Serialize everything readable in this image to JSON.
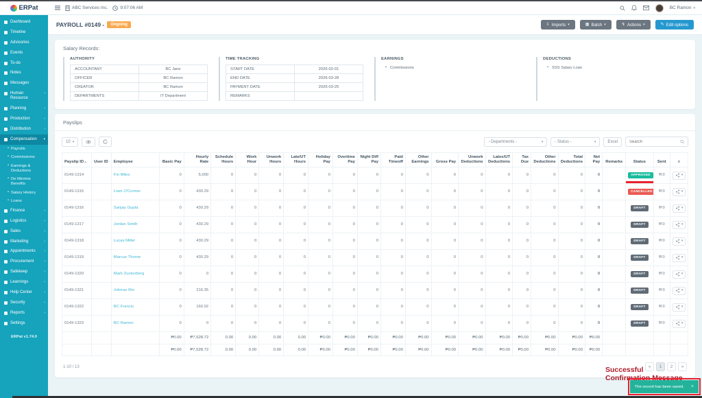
{
  "chrome": {
    "logo": {
      "text": "ERPat"
    },
    "topbar": {
      "company": "ABC Services Inc.",
      "time": "9:07:06 AM",
      "user": "BC Ramon"
    }
  },
  "sidebar": {
    "version": "ERPat v1.74.0",
    "sections": [
      {
        "type": "link",
        "label": "Dashboard",
        "icon": "dashboard-icon"
      },
      {
        "type": "link",
        "label": "Timeline",
        "icon": "timeline-icon"
      },
      {
        "type": "link",
        "label": "Advisories",
        "icon": "advisories-icon"
      },
      {
        "type": "link",
        "label": "Events",
        "icon": "events-icon"
      },
      {
        "type": "link",
        "label": "To-do",
        "icon": "todo-icon"
      },
      {
        "type": "link",
        "label": "Notes",
        "icon": "notes-icon"
      },
      {
        "type": "link",
        "label": "Messages",
        "icon": "messages-icon"
      },
      {
        "type": "parent",
        "label": "Human Resource",
        "icon": "human-resource-icon"
      },
      {
        "type": "parent",
        "label": "Planning",
        "icon": "planning-icon"
      },
      {
        "type": "parent",
        "label": "Production",
        "icon": "production-icon"
      },
      {
        "type": "parent",
        "label": "Distribution",
        "icon": "distribution-icon"
      },
      {
        "type": "parent",
        "label": "Compensation",
        "icon": "compensation-icon",
        "active": true,
        "expanded": true,
        "children": [
          "Payrolls",
          "Commissions",
          "Earnings & Deductions",
          "De Minimis Benefits",
          "Salary History",
          "Loans"
        ]
      },
      {
        "type": "parent",
        "label": "Finance",
        "icon": "finance-icon"
      },
      {
        "type": "parent",
        "label": "Logistics",
        "icon": "logistics-icon"
      },
      {
        "type": "parent",
        "label": "Sales",
        "icon": "sales-icon"
      },
      {
        "type": "parent",
        "label": "Marketing",
        "icon": "marketing-icon"
      },
      {
        "type": "parent",
        "label": "Appointments",
        "icon": "appointments-icon"
      },
      {
        "type": "parent",
        "label": "Procurement",
        "icon": "procurement-icon"
      },
      {
        "type": "parent",
        "label": "Safekeep",
        "icon": "safekeep-icon"
      },
      {
        "type": "parent",
        "label": "Learnings",
        "icon": "learnings-icon"
      },
      {
        "type": "parent",
        "label": "Help Center",
        "icon": "help-center-icon"
      },
      {
        "type": "parent",
        "label": "Security",
        "icon": "security-icon"
      },
      {
        "type": "parent",
        "label": "Reports",
        "icon": "reports-icon"
      },
      {
        "type": "link",
        "label": "Settings",
        "icon": "settings-icon"
      }
    ]
  },
  "page": {
    "title": "PAYROLL #0149 -",
    "status_badge": "Ongoing",
    "buttons": [
      {
        "label": "Imports",
        "caret": "▾",
        "icon": "imports-icon",
        "glyph": "⇩",
        "style": "dark"
      },
      {
        "label": "Batch",
        "caret": "▾",
        "icon": "batch-icon",
        "glyph": "▦",
        "style": "dark"
      },
      {
        "label": "Actions",
        "caret": "▾",
        "icon": "actions-icon",
        "glyph": "↯",
        "style": "dark"
      },
      {
        "label": "Edit options",
        "caret": "",
        "icon": "edit-icon",
        "glyph": "✎",
        "style": "info"
      }
    ]
  },
  "salary_records": {
    "heading": "Salary Records:",
    "authority": {
      "title": "AUTHORITY",
      "rows": [
        [
          "ACCOUNTANT",
          "BC Jane"
        ],
        [
          "OFFICER",
          "BC Ramon"
        ],
        [
          "CREATOR",
          "BC Ramon"
        ],
        [
          "DEPARTMENTS",
          "IT Department"
        ]
      ]
    },
    "time_tracking": {
      "title": "TIME TRACKING",
      "rows": [
        [
          "START DATE",
          "2026-02-01"
        ],
        [
          "END DATE",
          "2026-03-28"
        ],
        [
          "PAYMENT DATE",
          "2026-03-25"
        ],
        [
          "REMARKS",
          ""
        ]
      ]
    },
    "earnings": {
      "title": "EARNINGS",
      "items": [
        "Commissions"
      ]
    },
    "deductions": {
      "title": "DEDUCTIONS",
      "items": [
        "SSS Salary Loan"
      ]
    }
  },
  "payslips": {
    "heading": "Payslips",
    "page_size": "10",
    "filters": {
      "departments": "- Departments -",
      "status": "- Status -",
      "excel_label": "Excel",
      "search_placeholder": "Search"
    },
    "table": {
      "columns": [
        {
          "label": "Payslip ID",
          "align": "l",
          "w": 4.8,
          "sort": true
        },
        {
          "label": "User ID",
          "align": "l",
          "w": 3.2
        },
        {
          "label": "Employee",
          "align": "l",
          "w": 7.8
        },
        {
          "label": "Basic Pay",
          "align": "r",
          "w": 4.0
        },
        {
          "label": "Hourly Rate",
          "align": "r",
          "w": 4.4
        },
        {
          "label": "Schedule Hours",
          "align": "r",
          "w": 4.0
        },
        {
          "label": "Work Hour",
          "align": "r",
          "w": 3.8
        },
        {
          "label": "Unwork Hours",
          "align": "r",
          "w": 4.0
        },
        {
          "label": "Late/UT Hours",
          "align": "r",
          "w": 4.0
        },
        {
          "label": "Holiday Pay",
          "align": "r",
          "w": 4.0
        },
        {
          "label": "Overtime Pay",
          "align": "r",
          "w": 4.0
        },
        {
          "label": "Night Diff Pay",
          "align": "r",
          "w": 3.8
        },
        {
          "label": "Paid Timeoff",
          "align": "r",
          "w": 4.0
        },
        {
          "label": "Other Earnings",
          "align": "r",
          "w": 4.2
        },
        {
          "label": "Gross Pay",
          "align": "r",
          "w": 4.4
        },
        {
          "label": "Unwork Deductions",
          "align": "r",
          "w": 4.4
        },
        {
          "label": "Lates/UT Deductions",
          "align": "r",
          "w": 4.4
        },
        {
          "label": "Tax Due",
          "align": "r",
          "w": 3.0
        },
        {
          "label": "Other Deductions",
          "align": "r",
          "w": 4.4
        },
        {
          "label": "Total Deductions",
          "align": "r",
          "w": 4.4
        },
        {
          "label": "Net Pay",
          "align": "r",
          "w": 2.8
        },
        {
          "label": "Remarks",
          "align": "c",
          "w": 3.8
        },
        {
          "label": "Status",
          "align": "c",
          "w": 4.5
        },
        {
          "label": "Sent",
          "align": "c",
          "w": 2.7
        },
        {
          "label": "≡",
          "align": "c",
          "w": 2.9,
          "menu": true
        }
      ],
      "rows": [
        [
          "0149-1314",
          "",
          "Fin Miles",
          "0",
          "5,000",
          "0",
          "0",
          "0",
          "0",
          "0",
          "0",
          "0",
          "0",
          "0",
          "0",
          "0",
          "0",
          "0",
          "0",
          "0",
          "0",
          "",
          "APPROVED",
          "0",
          ""
        ],
        [
          "0149-1315",
          "",
          "Liam O'Connor",
          "0",
          "430.29",
          "0",
          "0",
          "0",
          "0",
          "0",
          "0",
          "0",
          "0",
          "0",
          "0",
          "0",
          "0",
          "0",
          "0",
          "0",
          "0",
          "",
          "CANCELLED",
          "0",
          ""
        ],
        [
          "0149-1316",
          "",
          "Sanjay Gupta",
          "0",
          "430.29",
          "0",
          "0",
          "0",
          "0",
          "0",
          "0",
          "0",
          "0",
          "0",
          "0",
          "0",
          "0",
          "0",
          "0",
          "0",
          "0",
          "",
          "DRAFT",
          "0",
          ""
        ],
        [
          "0149-1317",
          "",
          "Jordan Smith",
          "0",
          "430.29",
          "0",
          "0",
          "0",
          "0",
          "0",
          "0",
          "0",
          "0",
          "0",
          "0",
          "0",
          "0",
          "0",
          "0",
          "0",
          "0",
          "",
          "DRAFT",
          "0",
          ""
        ],
        [
          "0149-1318",
          "",
          "Lucas Miller",
          "0",
          "430.29",
          "0",
          "0",
          "0",
          "0",
          "0",
          "0",
          "0",
          "0",
          "0",
          "0",
          "0",
          "0",
          "0",
          "0",
          "0",
          "0",
          "",
          "DRAFT",
          "0",
          ""
        ],
        [
          "0149-1319",
          "",
          "Marcus Thorne",
          "0",
          "430.29",
          "0",
          "0",
          "0",
          "0",
          "0",
          "0",
          "0",
          "0",
          "0",
          "0",
          "0",
          "0",
          "0",
          "0",
          "0",
          "0",
          "",
          "DRAFT",
          "0",
          ""
        ],
        [
          "0149-1320",
          "",
          "Mark Zuckerberg",
          "0",
          "0",
          "0",
          "0",
          "0",
          "0",
          "0",
          "0",
          "0",
          "0",
          "0",
          "0",
          "0",
          "0",
          "0",
          "0",
          "0",
          "0",
          "",
          "DRAFT",
          "0",
          ""
        ],
        [
          "0149-1321",
          "",
          "Johmar Rio",
          "0",
          "216.35",
          "0",
          "0",
          "0",
          "0",
          "0",
          "0",
          "0",
          "0",
          "0",
          "0",
          "0",
          "0",
          "0",
          "0",
          "0",
          "0",
          "",
          "DRAFT",
          "0",
          ""
        ],
        [
          "0149-1322",
          "",
          "BC Francis",
          "0",
          "160.92",
          "0",
          "0",
          "0",
          "0",
          "0",
          "0",
          "0",
          "0",
          "0",
          "0",
          "0",
          "0",
          "0",
          "0",
          "0",
          "0",
          "",
          "DRAFT",
          "0",
          ""
        ],
        [
          "0149-1323",
          "",
          "BC Ramon",
          "0",
          "0",
          "0",
          "0",
          "0",
          "0",
          "0",
          "0",
          "0",
          "0",
          "0",
          "0",
          "0",
          "0",
          "0",
          "0",
          "0",
          "0",
          "",
          "DRAFT",
          "0",
          ""
        ]
      ],
      "totals": [
        [
          "",
          "",
          "",
          "₱0.00",
          "₱7,528.72",
          "0.00",
          "0.00",
          "0.00",
          "0.00",
          "₱0.00",
          "₱0.00",
          "₱0.00",
          "₱0.00",
          "₱0.00",
          "₱0.00",
          "₱0.00",
          "₱0.00",
          "₱0.00",
          "₱0.00",
          "₱0.00",
          "₱0.00",
          "",
          "",
          "",
          ""
        ],
        [
          "",
          "",
          "",
          "₱0.00",
          "₱7,528.72",
          "0.00",
          "0.00",
          "0.00",
          "0.00",
          "₱0.00",
          "₱0.00",
          "₱0.00",
          "₱0.00",
          "₱0.00",
          "₱0.00",
          "₱0.00",
          "₱0.00",
          "₱0.00",
          "₱0.00",
          "₱0.00",
          "₱0.00",
          "",
          "",
          "",
          ""
        ]
      ],
      "status_colors": {
        "APPROVED": "#1abc9c",
        "CANCELLED": "#e95c55",
        "DRAFT": "#5f6b76"
      }
    },
    "footer": {
      "range": "1-10 / 13",
      "pagination": [
        "«",
        "1",
        "2",
        "»"
      ],
      "active_page": "1"
    }
  },
  "annotation": {
    "heading": "Successful Confirmation Message",
    "toast_message": "The record has been saved.",
    "underline_row": 0
  }
}
